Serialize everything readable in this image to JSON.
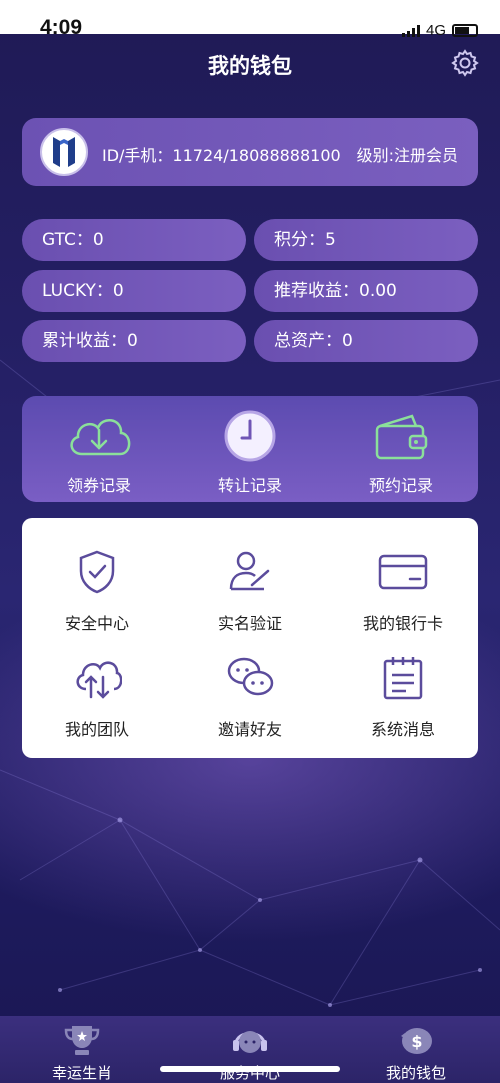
{
  "status_bar": {
    "time": "4:09",
    "network": "4G"
  },
  "header": {
    "title": "我的钱包"
  },
  "account": {
    "id_text": "ID/手机：11724/18088888100",
    "level_text": "级别:注册会员"
  },
  "balances": [
    {
      "label": "GTC：0"
    },
    {
      "label": "积分：5"
    },
    {
      "label": "LUCKY：0"
    },
    {
      "label": "推荐收益：0.00"
    },
    {
      "label": "累计收益：0"
    },
    {
      "label": "总资产：0"
    }
  ],
  "records": [
    {
      "label": "领券记录",
      "icon": "cloud-download-icon"
    },
    {
      "label": "转让记录",
      "icon": "clock-icon"
    },
    {
      "label": "预约记录",
      "icon": "wallet-icon"
    }
  ],
  "services": [
    {
      "label": "安全中心",
      "icon": "shield-check-icon"
    },
    {
      "label": "实名验证",
      "icon": "user-verify-icon"
    },
    {
      "label": "我的银行卡",
      "icon": "bank-card-icon"
    },
    {
      "label": "我的团队",
      "icon": "cloud-sync-icon"
    },
    {
      "label": "邀请好友",
      "icon": "chat-bubbles-icon"
    },
    {
      "label": "系统消息",
      "icon": "notepad-icon"
    }
  ],
  "tabbar": [
    {
      "label": "幸运生肖",
      "icon": "trophy-icon"
    },
    {
      "label": "服务中心",
      "icon": "headset-icon"
    },
    {
      "label": "我的钱包",
      "icon": "piggy-bank-icon"
    }
  ],
  "colors": {
    "accent": "#7a5fc0",
    "background": "#1f1b55",
    "card": "#ffffff",
    "icon_green": "#8be09a",
    "icon_purple": "#5b4c9c"
  }
}
